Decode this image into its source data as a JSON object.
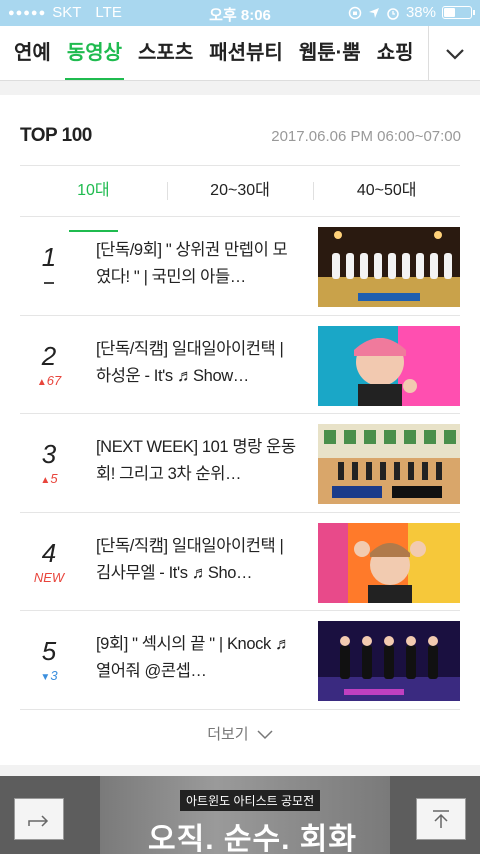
{
  "status_bar": {
    "carrier": "SKT",
    "network": "LTE",
    "time": "오후 8:06",
    "battery": "38%",
    "battery_level": 0.38
  },
  "nav": {
    "tabs": [
      {
        "label": "연예",
        "active": false
      },
      {
        "label": "동영상",
        "active": true
      },
      {
        "label": "스포츠",
        "active": false
      },
      {
        "label": "패션뷰티",
        "active": false
      },
      {
        "label": "웹툰·뿜",
        "active": false
      },
      {
        "label": "쇼핑",
        "active": false
      }
    ]
  },
  "ranking": {
    "title": "TOP 100",
    "date": "2017.06.06 PM 06:00~07:00",
    "age_tabs": [
      {
        "label": "10대",
        "active": true
      },
      {
        "label": "20~30대",
        "active": false
      },
      {
        "label": "40~50대",
        "active": false
      }
    ],
    "items": [
      {
        "rank": "1",
        "change_type": "same",
        "change": "",
        "title": "[단독/9회] \" 상위권 만렙이 모였다! \" | 국민의 아들…",
        "thumb": "stage-group"
      },
      {
        "rank": "2",
        "change_type": "up",
        "change": "67",
        "title": "[단독/직캠] 일대일아이컨택 | 하성운 - It's ♬Show…",
        "thumb": "closeup-pink"
      },
      {
        "rank": "3",
        "change_type": "up",
        "change": "5",
        "title": "[NEXT WEEK] 101 명랑 운동회! 그리고 3차 순위…",
        "thumb": "gym"
      },
      {
        "rank": "4",
        "change_type": "new",
        "change": "NEW",
        "title": "[단독/직캠] 일대일아이컨택 | 김사무엘 - It's ♬Sho…",
        "thumb": "closeup-hands"
      },
      {
        "rank": "5",
        "change_type": "down",
        "change": "3",
        "title": "[9회] \" 섹시의 끝 \" | Knock ♬열어줘 @콘셉…",
        "thumb": "stage-dark"
      }
    ],
    "more_label": "더보기"
  },
  "banner": {
    "label": "아트윈도 아티스트 공모전",
    "slogan": "오직. 순수. 회화"
  },
  "colors": {
    "accent": "#1fbb4f",
    "status_bar": "#a9d7ef",
    "up": "#e8453c",
    "down": "#3b8fde"
  }
}
